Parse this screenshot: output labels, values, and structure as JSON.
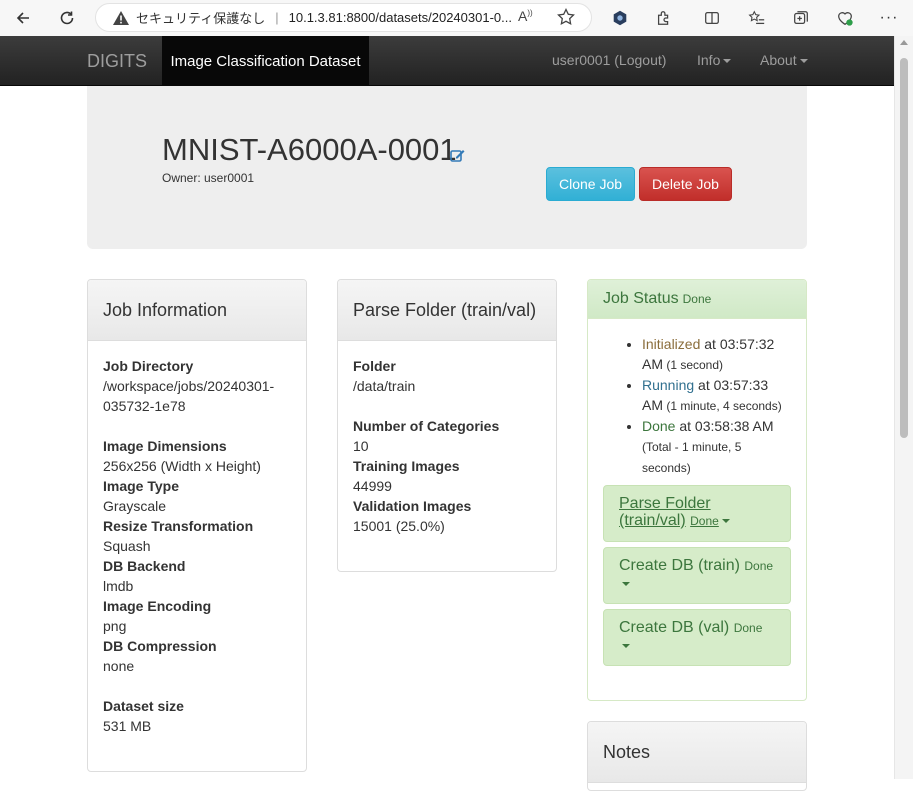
{
  "browser": {
    "security_label": "セキュリティ保護なし",
    "url": "10.1.3.81:8800/datasets/20240301-0..."
  },
  "navbar": {
    "brand": "DIGITS",
    "active": "Image Classification Dataset",
    "user": "user0001 (Logout)",
    "info": "Info",
    "about": "About"
  },
  "header": {
    "job_name": "MNIST-A6000A-0001",
    "owner": "Owner: user0001",
    "clone_label": "Clone Job",
    "delete_label": "Delete Job"
  },
  "job_info": {
    "title": "Job Information",
    "directory_label": "Job Directory",
    "directory_line1": "/workspace/jobs/20240301-",
    "directory_line2": "035732-1e78",
    "dimensions_label": "Image Dimensions",
    "dimensions": "256x256 (Width x Height)",
    "type_label": "Image Type",
    "type": "Grayscale",
    "resize_label": "Resize Transformation",
    "resize": "Squash",
    "backend_label": "DB Backend",
    "backend": "lmdb",
    "encoding_label": "Image Encoding",
    "encoding": "png",
    "compression_label": "DB Compression",
    "compression": "none",
    "size_label": "Dataset size",
    "size": "531 MB"
  },
  "parse_folder": {
    "title": "Parse Folder (train/val)",
    "folder_label": "Folder",
    "folder": "/data/train",
    "categories_label": "Number of Categories",
    "categories": "10",
    "training_label": "Training Images",
    "training": "44999",
    "validation_label": "Validation Images",
    "validation": "15001 (25.0%)"
  },
  "job_status": {
    "title": "Job Status",
    "status": "Done",
    "events": [
      {
        "state": "Initialized",
        "time": " at 03:57:32",
        "line2": "AM",
        "duration": " (1 second)"
      },
      {
        "state": "Running",
        "time": " at 03:57:33",
        "line2": "AM",
        "duration": " (1 minute, 4 seconds)"
      },
      {
        "state": "Done",
        "time": " at 03:58:38 AM",
        "line2": "(Total - 1 minute, 5",
        "duration": "seconds)"
      }
    ],
    "tasks": [
      {
        "line1": "Parse Folder",
        "line2": "(train/val)",
        "status": "Done"
      },
      {
        "name": "Create DB (train)",
        "status": "Done"
      },
      {
        "name": "Create DB (val)",
        "status": "Done"
      }
    ]
  },
  "notes": {
    "title": "Notes"
  }
}
